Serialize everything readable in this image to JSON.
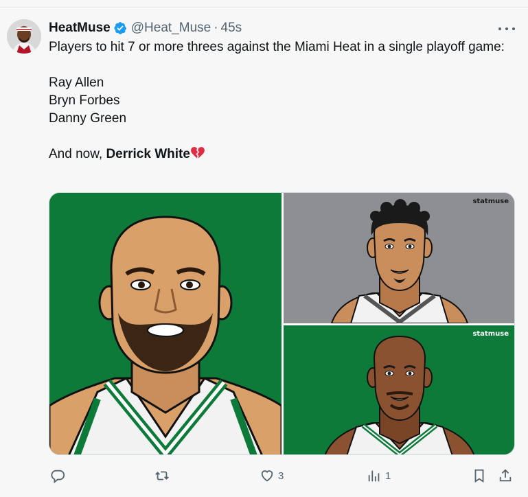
{
  "tweet": {
    "display_name": "HeatMuse",
    "handle": "@Heat_Muse",
    "separator": "·",
    "time": "45s",
    "lines": [
      "Players to hit 7 or more threes against the Miami Heat in a single playoff game:",
      "Ray Allen",
      "Bryn Forbes",
      "Danny Green"
    ],
    "closing_prefix": "And now, ",
    "closing_bold": "Derrick White",
    "emoji": "broken-heart"
  },
  "media": {
    "watermark": "statmuse",
    "images": [
      {
        "subject": "cartoon-player-bald-bearded-green-jersey",
        "bg": "#0d7a3a"
      },
      {
        "subject": "cartoon-player-curly-hair-gray-bg",
        "bg": "#8e8f93"
      },
      {
        "subject": "cartoon-player-bald-green-jersey",
        "bg": "#0d7a3a"
      }
    ]
  },
  "actions": {
    "reply_count": "",
    "retweet_count": "",
    "like_count": "3",
    "views_count": "1"
  },
  "icons": {
    "verified": "verified-badge-icon",
    "more": "more-icon",
    "reply": "reply-icon",
    "retweet": "retweet-icon",
    "like": "heart-icon",
    "views": "views-icon",
    "bookmark": "bookmark-icon",
    "share": "share-icon"
  },
  "colors": {
    "verified_blue": "#1d9bf0",
    "secondary_text": "#536471",
    "celtics_green": "#0d7a3a",
    "heart_red": "#dd2e44"
  }
}
